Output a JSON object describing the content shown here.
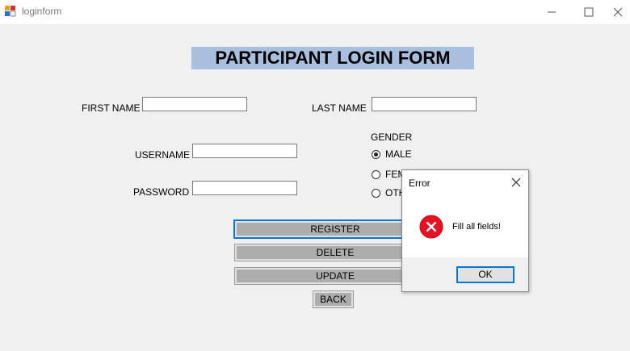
{
  "window": {
    "title": "loginform",
    "minimize_icon": "minimize-icon",
    "maximize_icon": "maximize-icon",
    "close_icon": "close-icon"
  },
  "form": {
    "title": "PARTICIPANT LOGIN FORM",
    "first_name_label": "FIRST NAME",
    "first_name_value": "",
    "last_name_label": "LAST NAME",
    "last_name_value": "",
    "username_label": "USERNAME",
    "username_value": "",
    "password_label": "PASSWORD",
    "password_value": "",
    "gender_label": "GENDER",
    "gender_options": [
      {
        "label": "MALE",
        "checked": true
      },
      {
        "label": "FEM",
        "checked": false
      },
      {
        "label": "OTH",
        "checked": false
      }
    ],
    "buttons": {
      "register": "REGISTER",
      "delete": "DELETE",
      "update": "UPDATE",
      "back": "BACK"
    }
  },
  "dialog": {
    "title": "Error",
    "message": "Fill all fields!",
    "ok_label": "OK",
    "icon": "error-icon",
    "icon_color": "#e81123"
  },
  "colors": {
    "title_highlight": "#a8c0de",
    "focus": "#0078d7",
    "background": "#f0f0f0"
  }
}
